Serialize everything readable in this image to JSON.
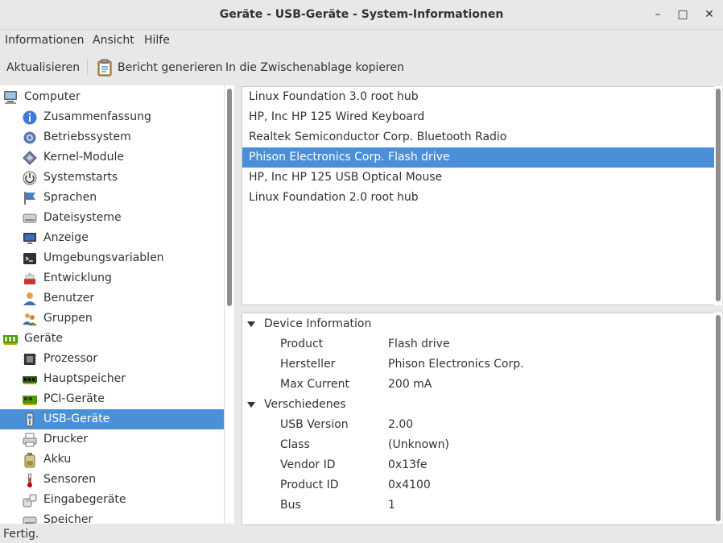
{
  "window": {
    "title": "Geräte - USB-Geräte - System-Informationen",
    "minimize": "–",
    "maximize": "□",
    "close": "✕"
  },
  "menu": [
    "Informationen",
    "Ansicht",
    "Hilfe"
  ],
  "toolbar": {
    "refresh": "Aktualisieren",
    "report": "Bericht generieren",
    "copy": "In die Zwischenablage kopieren"
  },
  "sidebar": {
    "items": [
      {
        "label": "Computer",
        "icon": "computer-icon",
        "level": 0
      },
      {
        "label": "Zusammenfassung",
        "icon": "summary-icon",
        "level": 1
      },
      {
        "label": "Betriebssystem",
        "icon": "gear-icon",
        "level": 1
      },
      {
        "label": "Kernel-Module",
        "icon": "module-icon",
        "level": 1
      },
      {
        "label": "Systemstarts",
        "icon": "power-icon",
        "level": 1
      },
      {
        "label": "Sprachen",
        "icon": "flag-icon",
        "level": 1
      },
      {
        "label": "Dateisysteme",
        "icon": "drive-icon",
        "level": 1
      },
      {
        "label": "Anzeige",
        "icon": "monitor-icon",
        "level": 1
      },
      {
        "label": "Umgebungsvariablen",
        "icon": "terminal-icon",
        "level": 1
      },
      {
        "label": "Entwicklung",
        "icon": "development-icon",
        "level": 1
      },
      {
        "label": "Benutzer",
        "icon": "user-icon",
        "level": 1
      },
      {
        "label": "Gruppen",
        "icon": "group-icon",
        "level": 1
      },
      {
        "label": "Geräte",
        "icon": "devices-icon",
        "level": 0
      },
      {
        "label": "Prozessor",
        "icon": "processor-icon",
        "level": 1
      },
      {
        "label": "Hauptspeicher",
        "icon": "memory-icon",
        "level": 1
      },
      {
        "label": "PCI-Geräte",
        "icon": "pci-icon",
        "level": 1
      },
      {
        "label": "USB-Geräte",
        "icon": "usb-icon",
        "level": 1,
        "selected": true
      },
      {
        "label": "Drucker",
        "icon": "printer-icon",
        "level": 1
      },
      {
        "label": "Akku",
        "icon": "battery-icon",
        "level": 1
      },
      {
        "label": "Sensoren",
        "icon": "thermometer-icon",
        "level": 1
      },
      {
        "label": "Eingabegeräte",
        "icon": "input-device-icon",
        "level": 1
      },
      {
        "label": "Speicher",
        "icon": "storage-icon",
        "level": 1
      }
    ]
  },
  "devices": [
    "Linux Foundation 3.0 root hub",
    "HP, Inc HP 125 Wired Keyboard",
    "Realtek Semiconductor Corp. Bluetooth Radio",
    "Phison Electronics Corp. Flash drive",
    "HP, Inc HP 125 USB Optical Mouse",
    "Linux Foundation 2.0 root hub"
  ],
  "selected_device_index": 3,
  "details": {
    "sections": [
      {
        "title": "Device Information",
        "rows": [
          {
            "key": "Product",
            "value": "Flash drive"
          },
          {
            "key": "Hersteller",
            "value": "Phison Electronics Corp."
          },
          {
            "key": "Max Current",
            "value": "200 mA"
          }
        ]
      },
      {
        "title": "Verschiedenes",
        "rows": [
          {
            "key": "USB Version",
            "value": "2.00"
          },
          {
            "key": "Class",
            "value": "(Unknown)"
          },
          {
            "key": "Vendor ID",
            "value": "0x13fe"
          },
          {
            "key": "Product ID",
            "value": "0x4100"
          },
          {
            "key": "Bus",
            "value": "1"
          }
        ]
      }
    ]
  },
  "status": "Fertig."
}
